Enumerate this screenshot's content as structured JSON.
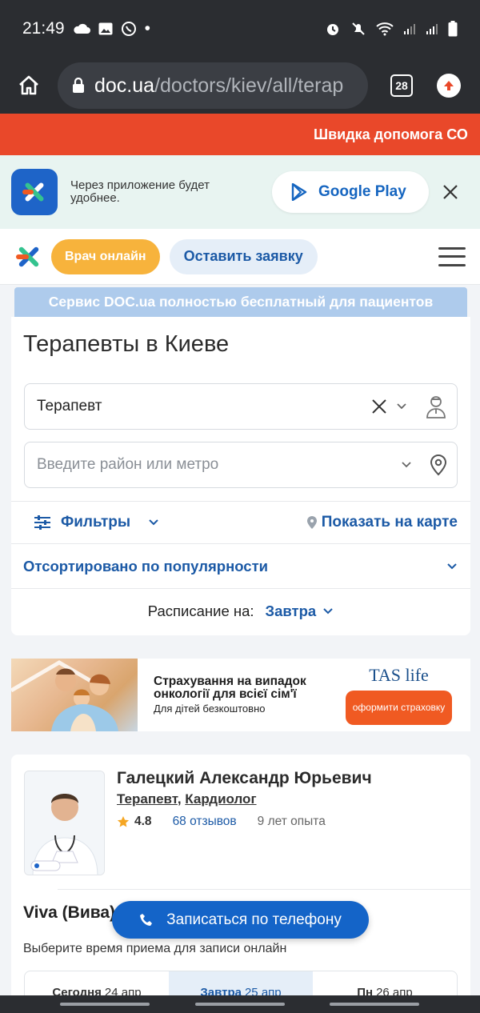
{
  "status_bar": {
    "time": "21:49",
    "dot": "•"
  },
  "browser": {
    "url_host": "doc.ua",
    "url_path": "/doctors/kiev/all/terap",
    "tab_count": "28"
  },
  "alert_banner": {
    "text": "Швидка допомога СО"
  },
  "app_banner": {
    "text": "Через приложение будет удобнее.",
    "store_button": "Google Play"
  },
  "header": {
    "online_button": "Врач онлайн",
    "request_button": "Оставить заявку"
  },
  "info_strip": "Сервис DOC.ua полностью бесплатный для пациентов",
  "page_title": "Терапевты в Киеве",
  "search": {
    "specialty_value": "Терапевт",
    "district_placeholder": "Введите район или метро",
    "filters_label": "Фильтры",
    "map_link": "Показать на карте",
    "sort_label": "Отсортировано по популярности",
    "schedule_label": "Расписание на:",
    "schedule_value": "Завтра"
  },
  "ad": {
    "line1": "Страхування на випадок онкології для всієї сім'ї",
    "line2": "Для дітей безкоштовно",
    "brand": "TAS life",
    "button": "оформити страховку"
  },
  "doctor": {
    "name": "Галецкий Александр Юрьевич",
    "specialty1": "Терапевт",
    "separator": ", ",
    "specialty2": "Кардиолог",
    "rating": "4.8",
    "reviews": "68 отзывов",
    "experience": "9 лет опыта",
    "clinic": "Viva (Вива)",
    "choose_time": "Выберите время приема для записи онлайн",
    "days": [
      {
        "label": "Сегодня",
        "date": "24 апр"
      },
      {
        "label": "Завтра",
        "date": "25 апр"
      },
      {
        "label": "Пн",
        "date": "26 апр"
      }
    ]
  },
  "call_button": "Записаться по телефону",
  "colors": {
    "primary": "#1464c8",
    "alert": "#e9482a",
    "online_button": "#f7b33c",
    "ad_button": "#f05a22"
  }
}
